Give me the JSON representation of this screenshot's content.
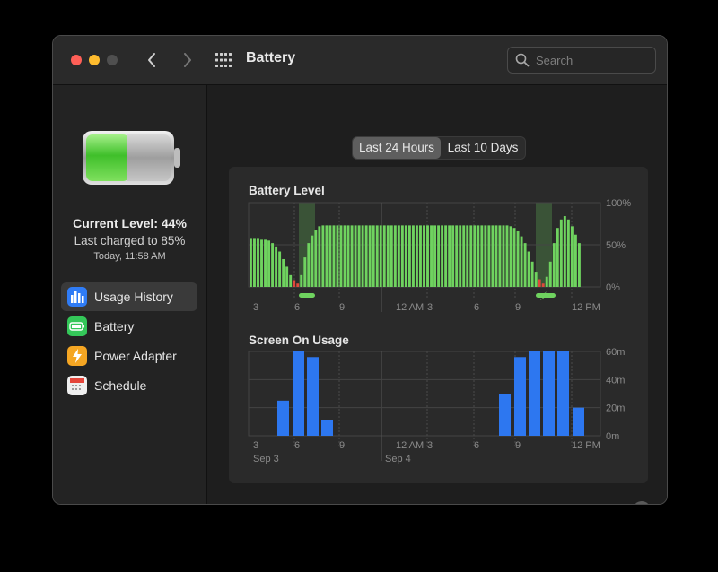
{
  "window": {
    "title": "Battery",
    "search_placeholder": "Search"
  },
  "sidebar": {
    "current_level": "Current Level: 44%",
    "last_charged": "Last charged to 85%",
    "last_charged_time": "Today, 11:58 AM",
    "items": [
      {
        "label": "Usage History",
        "icon": "bar-chart-icon",
        "color": "#2f7cf6",
        "selected": true
      },
      {
        "label": "Battery",
        "icon": "battery-icon",
        "color": "#34c759",
        "selected": false
      },
      {
        "label": "Power Adapter",
        "icon": "lightning-icon",
        "color": "#f5a623",
        "selected": false
      },
      {
        "label": "Schedule",
        "icon": "calendar-icon",
        "color": "#e8e8e8",
        "selected": false
      }
    ]
  },
  "main": {
    "segments": [
      "Last 24 Hours",
      "Last 10 Days"
    ],
    "selected_segment": 0
  },
  "colors": {
    "battery_bar": "#6fd35f",
    "low_bar": "#e0483c",
    "charging_band": "#3d5a3a",
    "screen_bar": "#2d77f0"
  },
  "chart_data": [
    {
      "type": "bar",
      "title": "Battery Level",
      "y_ticks": [
        "100%",
        "50%",
        "0%"
      ],
      "ylim": [
        0,
        100
      ],
      "x_ticks": [
        "3",
        "6",
        "9",
        "12 AM",
        "3",
        "6",
        "9",
        "12 PM"
      ],
      "charging_markers": [
        {
          "from_hour": 6.1,
          "to_hour": 7.2
        },
        {
          "from_hour": 9.5,
          "to_hour": 10.7
        }
      ],
      "charging_symbol": "⚡",
      "values": [
        57,
        57,
        57,
        56,
        56,
        55,
        52,
        48,
        42,
        33,
        24,
        14,
        8,
        4,
        14,
        35,
        52,
        61,
        67,
        72,
        73,
        73,
        73,
        73,
        73,
        73,
        73,
        73,
        73,
        73,
        73,
        73,
        73,
        73,
        73,
        73,
        73,
        73,
        73,
        73,
        73,
        73,
        73,
        73,
        73,
        73,
        73,
        73,
        73,
        73,
        73,
        73,
        73,
        73,
        73,
        73,
        73,
        73,
        73,
        73,
        73,
        73,
        73,
        73,
        73,
        73,
        73,
        73,
        73,
        73,
        73,
        73,
        72,
        70,
        66,
        60,
        52,
        42,
        30,
        18,
        9,
        4,
        12,
        30,
        52,
        70,
        80,
        84,
        80,
        72,
        62,
        52
      ],
      "low_threshold": 10
    },
    {
      "type": "bar",
      "title": "Screen On Usage",
      "y_ticks": [
        "60m",
        "40m",
        "20m",
        "0m"
      ],
      "ylim": [
        0,
        60
      ],
      "x_ticks": [
        "3",
        "6",
        "9",
        "12 AM",
        "3",
        "6",
        "9",
        "12 PM"
      ],
      "date_labels": [
        "Sep 3",
        "Sep 4"
      ],
      "values": [
        0,
        25,
        60,
        56,
        11,
        0,
        0,
        0,
        0,
        0,
        0,
        0,
        0,
        0,
        0,
        0,
        0,
        30,
        56,
        60,
        60,
        60,
        20
      ]
    }
  ]
}
